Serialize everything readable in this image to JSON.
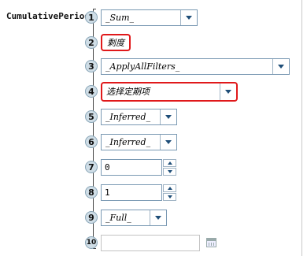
{
  "function_name": "CumulativePeriod",
  "params": [
    {
      "index": "1",
      "type": "combo",
      "value": "_Sum_"
    },
    {
      "index": "2",
      "type": "text",
      "value": "剩度"
    },
    {
      "index": "3",
      "type": "combo",
      "value": "_ApplyAllFilters_"
    },
    {
      "index": "4",
      "type": "combo",
      "value": "选择定期项"
    },
    {
      "index": "5",
      "type": "combo",
      "value": "_Inferred_"
    },
    {
      "index": "6",
      "type": "combo",
      "value": "_Inferred_"
    },
    {
      "index": "7",
      "type": "spin",
      "value": "0"
    },
    {
      "index": "8",
      "type": "spin",
      "value": "1"
    },
    {
      "index": "9",
      "type": "combo",
      "value": "_Full_"
    },
    {
      "index": "10",
      "type": "date",
      "value": ""
    }
  ],
  "colors": {
    "highlight": "#e0191b",
    "badge": "#cfdde6",
    "arrow": "#1f4e78"
  },
  "icons": {
    "dropdown": "chevron-down-icon",
    "spin_up": "spin-up-icon",
    "spin_down": "spin-down-icon",
    "calendar": "calendar-icon"
  }
}
